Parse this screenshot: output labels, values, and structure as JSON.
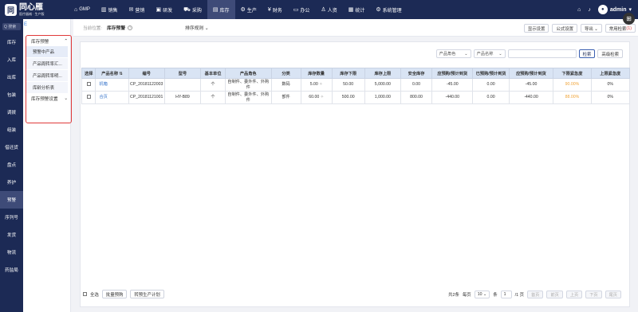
{
  "app": {
    "logo_mark": "同",
    "name": "同心雁",
    "tagline": "医疗器械 · 生产版"
  },
  "topnav": [
    {
      "icon": "⌂",
      "label": "GMP"
    },
    {
      "icon": "▥",
      "label": "销售"
    },
    {
      "icon": "✉",
      "label": "营销"
    },
    {
      "icon": "▣",
      "label": "研发"
    },
    {
      "icon": "⛟",
      "label": "采购"
    },
    {
      "icon": "▤",
      "label": "库存"
    },
    {
      "icon": "⚙",
      "label": "生产"
    },
    {
      "icon": "¥",
      "label": "财务"
    },
    {
      "icon": "▭",
      "label": "办公"
    },
    {
      "icon": "♙",
      "label": "人资"
    },
    {
      "icon": "▦",
      "label": "统计"
    },
    {
      "icon": "⚙",
      "label": "系统管理"
    }
  ],
  "topright": {
    "home_icon": "⌂",
    "bell_icon": "♪",
    "username": "admin",
    "user_icon": "▾"
  },
  "sidebar": {
    "search_placeholder": "Q 搜索",
    "items": [
      "库存",
      "入库",
      "出库",
      "包装",
      "调拨",
      "组装",
      "借还货",
      "盘点",
      "养护",
      "预警",
      "序列号",
      "发货",
      "物流",
      "药监局"
    ]
  },
  "subpanel": {
    "collapse": "E",
    "group1": "库存预警",
    "items": [
      "预警中产品",
      "产品周转率汇...",
      "产品周转率明...",
      "库龄分析表"
    ],
    "group2": "库存预警设置"
  },
  "crumb": {
    "label": "当前位置:",
    "value": "库存预警",
    "help": "?",
    "sort": "排序规则 ⌄"
  },
  "top_buttons": [
    "显示设置",
    "公式设置",
    "导出 ⌄"
  ],
  "advanced_btn": {
    "label": "常用检索",
    "count": "(1)"
  },
  "float_btn": "⊞",
  "filter": {
    "sel1": "产品角色",
    "sel2": "产品名称",
    "search": "检索",
    "advanced": "高级检索"
  },
  "table": {
    "headers": [
      "选择",
      "产品名称 ⇅",
      "编号",
      "型号",
      "基本单位",
      "产品角色",
      "分类",
      "库存数量",
      "库存下限",
      "库存上限",
      "安全库存",
      "应预购/预计到货",
      "已预购/预计到货",
      "应预购/预计到货",
      "下限紧急度",
      "上限紧急度"
    ],
    "rows": [
      {
        "name": "机箱",
        "code": "CP_20181122003",
        "model": "",
        "unit": "个",
        "role": "自制件、委外件、外购件",
        "category": "数码",
        "qty": "5.00",
        "low": "50.00",
        "high": "5,000.00",
        "safe": "0.00",
        "v1": "-45.00",
        "v2": "0.00",
        "v3": "-45.00",
        "low_urg": "90.00%",
        "high_urg": "0%"
      },
      {
        "name": "合页",
        "code": "CP_20181121001",
        "model": "HY-B89",
        "unit": "个",
        "role": "自制件、委外件、外购件",
        "category": "部件",
        "qty": "60.00",
        "low": "500.00",
        "high": "1,000.00",
        "safe": "800.00",
        "v1": "-440.00",
        "v2": "0.00",
        "v3": "-440.00",
        "low_urg": "88.00%",
        "high_urg": "0%"
      }
    ]
  },
  "bottom": {
    "select_all": "全选",
    "batch": "批量预购",
    "convert": "转预生产计划"
  },
  "pager": {
    "total": "共2条",
    "per_page_label": "每页",
    "per_page": "10 ⌄",
    "unit": "条",
    "page": "1",
    "pages": "/1 页",
    "first": "首页",
    "prev": "前页",
    "up": "上页",
    "down": "下页",
    "last": "尾页"
  }
}
